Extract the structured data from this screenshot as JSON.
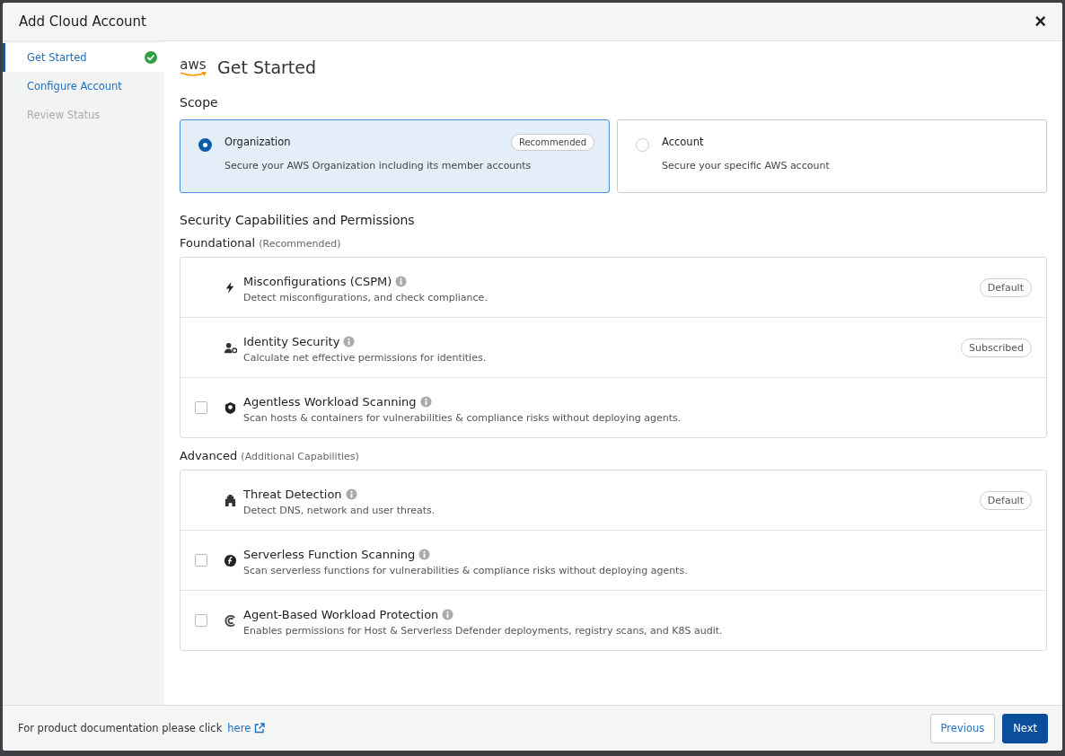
{
  "dialog": {
    "title": "Add Cloud Account",
    "close": "×"
  },
  "steps": [
    {
      "label": "Get Started",
      "selected": true,
      "completed": true,
      "disabled": false
    },
    {
      "label": "Configure Account",
      "selected": false,
      "completed": false,
      "disabled": false
    },
    {
      "label": "Review Status",
      "selected": false,
      "completed": false,
      "disabled": true
    }
  ],
  "provider_logo": "aws",
  "heading": "Get Started",
  "scope": {
    "title": "Scope",
    "options": [
      {
        "label": "Organization",
        "description": "Secure your AWS Organization including its member accounts",
        "badge": "Recommended",
        "selected": true
      },
      {
        "label": "Account",
        "description": "Secure your specific AWS account",
        "selected": false
      }
    ]
  },
  "capabilities_title": "Security Capabilities and Permissions",
  "groups": [
    {
      "title": "Foundational",
      "note": "(Recommended)",
      "items": [
        {
          "kind": "included",
          "name": "Misconfigurations (CSPM)",
          "description": "Detect misconfigurations, and check compliance.",
          "badge": "Default"
        },
        {
          "kind": "included",
          "name": "Identity Security",
          "description": "Calculate net effective permissions for identities.",
          "badge": "Subscribed"
        },
        {
          "kind": "optional",
          "name": "Agentless Workload Scanning",
          "description": "Scan hosts & containers for vulnerabilities & compliance risks without deploying agents.",
          "checked": false
        }
      ]
    },
    {
      "title": "Advanced",
      "note": "(Additional Capabilities)",
      "items": [
        {
          "kind": "included",
          "name": "Threat Detection",
          "description": "Detect DNS, network and user threats.",
          "badge": "Default"
        },
        {
          "kind": "optional",
          "name": "Serverless Function Scanning",
          "description": "Scan serverless functions for vulnerabilities & compliance risks without deploying agents.",
          "checked": false
        },
        {
          "kind": "optional",
          "name": "Agent-Based Workload Protection",
          "description": "Enables permissions for Host & Serverless Defender deployments, registry scans, and K8S audit.",
          "checked": false
        }
      ]
    }
  ],
  "footer": {
    "text": "For product documentation please click",
    "link": "here",
    "buttons": [
      {
        "label": "Previous",
        "kind": "secondary"
      },
      {
        "label": "Next",
        "kind": "primary"
      }
    ]
  }
}
